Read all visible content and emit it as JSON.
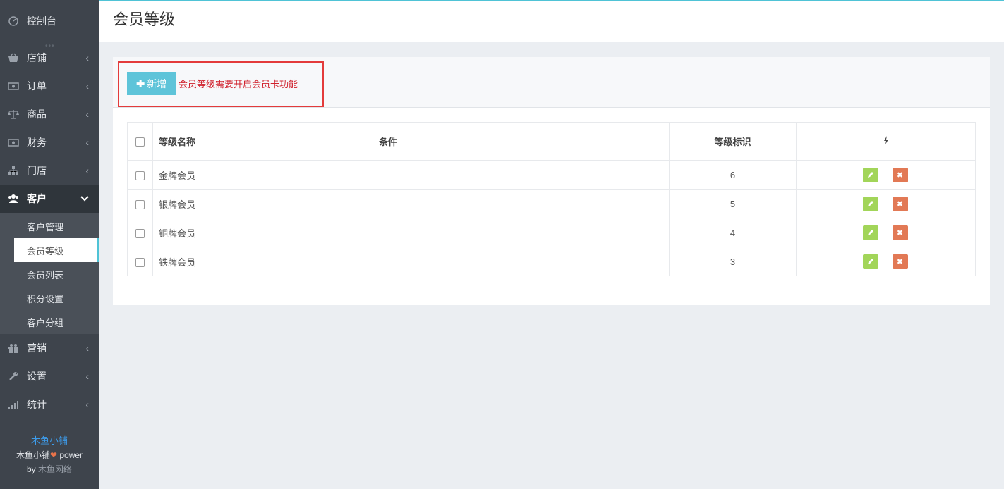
{
  "sidebar": {
    "dashboard": {
      "label": "控制台",
      "icon": "dashboard-icon"
    },
    "items": [
      {
        "label": "店铺",
        "icon": "shop-basket-icon"
      },
      {
        "label": "订单",
        "icon": "order-money-icon"
      },
      {
        "label": "商品",
        "icon": "scale-icon"
      },
      {
        "label": "财务",
        "icon": "finance-money-icon"
      },
      {
        "label": "门店",
        "icon": "sitemap-icon"
      }
    ],
    "customer": {
      "label": "客户",
      "icon": "users-icon",
      "submenu": [
        "客户管理",
        "会员等级",
        "会员列表",
        "积分设置",
        "客户分组"
      ]
    },
    "items_after": [
      {
        "label": "营销",
        "icon": "gift-icon"
      },
      {
        "label": "设置",
        "icon": "wrench-icon"
      },
      {
        "label": "统计",
        "icon": "signal-icon"
      }
    ],
    "footer": {
      "brand": "木鱼小铺",
      "power_prefix": "木鱼小铺",
      "power_suffix": " power",
      "by_prefix": "by ",
      "by_name": "木鱼网络"
    }
  },
  "header": {
    "title": "会员等级"
  },
  "toolbar": {
    "add_label": "新增",
    "notice": "会员等级需要开启会员卡功能"
  },
  "table": {
    "headers": {
      "name": "等级名称",
      "condition": "条件",
      "mark": "等级标识"
    },
    "rows": [
      {
        "name": "金牌会员",
        "condition": "",
        "mark": "6"
      },
      {
        "name": "银牌会员",
        "condition": "",
        "mark": "5"
      },
      {
        "name": "铜牌会员",
        "condition": "",
        "mark": "4"
      },
      {
        "name": "铁牌会员",
        "condition": "",
        "mark": "3"
      }
    ]
  },
  "colors": {
    "accent": "#4fc3d6",
    "sidebar": "#3e444c",
    "edit": "#a2d559",
    "delete": "#e27955",
    "notice": "#d01f2b",
    "highlight": "#e33b3b"
  }
}
